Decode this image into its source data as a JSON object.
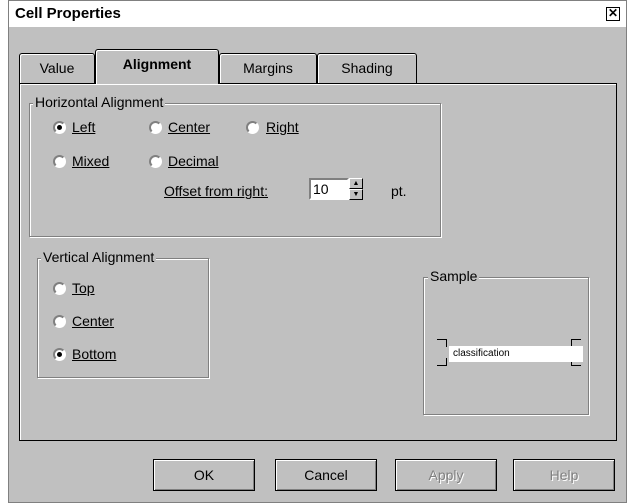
{
  "window": {
    "title": "Cell Properties",
    "close_glyph": "✕"
  },
  "tabs": [
    {
      "label": "Value",
      "active": false
    },
    {
      "label": "Alignment",
      "active": true
    },
    {
      "label": "Margins",
      "active": false
    },
    {
      "label": "Shading",
      "active": false
    }
  ],
  "horizontal": {
    "legend": "Horizontal Alignment",
    "left": "Left",
    "center": "Center",
    "right": "Right",
    "mixed": "Mixed",
    "decimal": "Decimal",
    "selected": "Left",
    "offset_label": "Offset from right:",
    "offset_value": "10",
    "offset_unit": "pt."
  },
  "vertical": {
    "legend": "Vertical Alignment",
    "top": "Top",
    "center": "Center",
    "bottom": "Bottom",
    "selected": "Bottom"
  },
  "sample": {
    "legend": "Sample",
    "text": "classification"
  },
  "buttons": {
    "ok": "OK",
    "cancel": "Cancel",
    "apply": "Apply",
    "help": "Help"
  },
  "colors": {
    "dialog_bg": "#c0c0c0",
    "field_bg": "#ffffff",
    "disabled_text": "#808080"
  }
}
